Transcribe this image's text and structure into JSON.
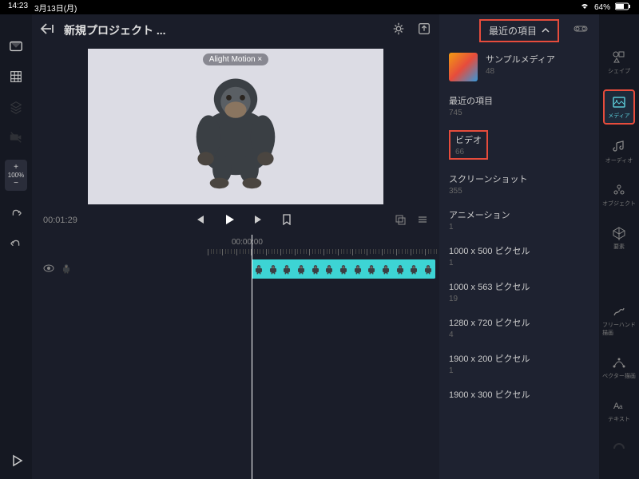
{
  "status": {
    "time": "14:23",
    "date": "3月13日(月)",
    "battery": "64%"
  },
  "header": {
    "title": "新規プロジェクト ..."
  },
  "preview": {
    "watermark": "Alight Motion ×"
  },
  "playback": {
    "currentTime": "00:01:29",
    "rulerTime": "00:00:00"
  },
  "zoom": {
    "plus": "+",
    "value": "100%",
    "minus": "−"
  },
  "mediaPanel": {
    "dropdown": "最近の項目",
    "items": [
      {
        "label": "サンプルメディア",
        "count": "48"
      },
      {
        "label": "最近の項目",
        "count": "745"
      },
      {
        "label": "ビデオ",
        "count": "66"
      },
      {
        "label": "スクリーンショット",
        "count": "355"
      },
      {
        "label": "アニメーション",
        "count": "1"
      },
      {
        "label": "1000 x 500 ピクセル",
        "count": "1"
      },
      {
        "label": "1000 x 563 ピクセル",
        "count": "19"
      },
      {
        "label": "1280 x 720 ピクセル",
        "count": "4"
      },
      {
        "label": "1900 x 200 ピクセル",
        "count": "1"
      },
      {
        "label": "1900 x 300 ピクセル",
        "count": ""
      }
    ]
  },
  "rightTools": {
    "shape": "シェイプ",
    "media": "メディア",
    "audio": "オーディオ",
    "object": "オブジェクト",
    "element": "要素",
    "freehand": "フリーハンド描画",
    "vector": "ベクター描画",
    "text": "テキスト"
  }
}
